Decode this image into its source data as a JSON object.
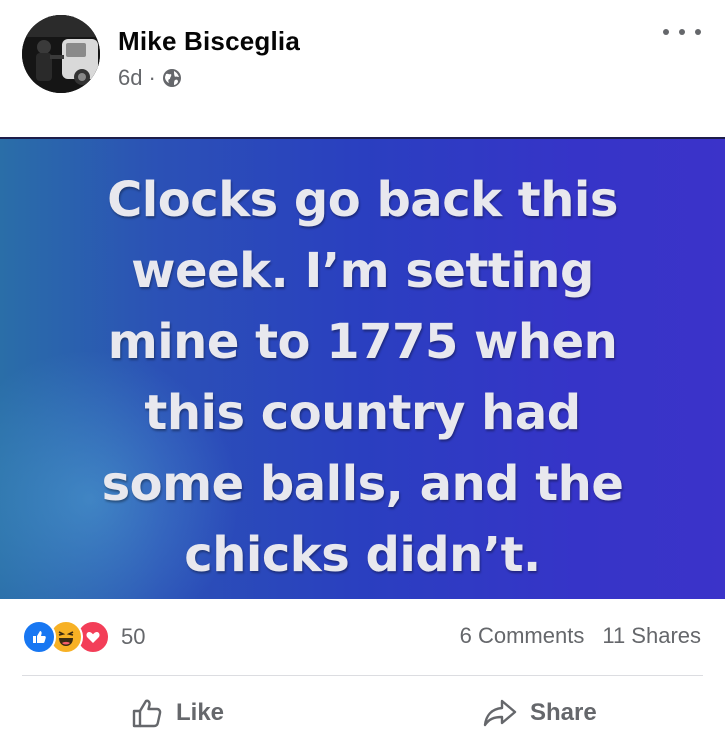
{
  "post": {
    "author_name": "Mike Bisceglia",
    "time_ago": "6d",
    "separator": "·",
    "privacy_icon": "globe-icon",
    "more_icon": "more-horizontal-icon"
  },
  "image": {
    "lines": [
      "Clocks go back this",
      "week. I’m setting",
      "mine to 1775 when",
      "this country had",
      "some balls, and the",
      "chicks didn’t."
    ],
    "colors": {
      "background_start": "#2a6ea8",
      "background_end": "#3b33c9",
      "text": "#e8e8ee"
    }
  },
  "stats": {
    "reaction_icons": [
      "like-reaction-icon",
      "haha-reaction-icon",
      "love-reaction-icon"
    ],
    "reaction_count": "50",
    "comments": "6 Comments",
    "shares": "11 Shares"
  },
  "actions": {
    "like_label": "Like",
    "share_label": "Share"
  },
  "colors": {
    "like_blue": "#1877f2",
    "haha_yellow": "#f7b125",
    "love_red": "#f33e58",
    "secondary_text": "#65676b"
  }
}
